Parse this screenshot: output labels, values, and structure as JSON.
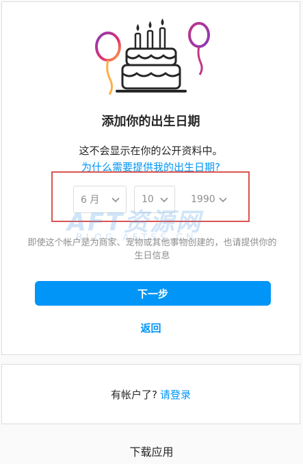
{
  "signup_birthday": {
    "title": "添加你的出生日期",
    "description": "这不会显示在你的公开资料中。",
    "why_link": "为什么需要提供我的出生日期?",
    "month_select": {
      "value": "6 月"
    },
    "day_select": {
      "value": "10"
    },
    "year_select": {
      "value": "1990"
    },
    "note": "即使这个帐户是为商家、宠物或其他事物创建的，也请提供你的生日信息",
    "next_button": "下一步",
    "back_link": "返回"
  },
  "login_card": {
    "prompt": "有帐户了?",
    "login_link": "请登录"
  },
  "footer": {
    "download_app": "下载应用"
  },
  "watermark": {
    "main": "AFT资源网",
    "sub": "BLOG.AFTSS.CN"
  },
  "colors": {
    "accent": "#0095f6",
    "highlight": "#d9534f",
    "balloon_pink": "#e1306c",
    "balloon_purple": "#8a3ab9",
    "balloon_orange": "#fcaf45"
  }
}
